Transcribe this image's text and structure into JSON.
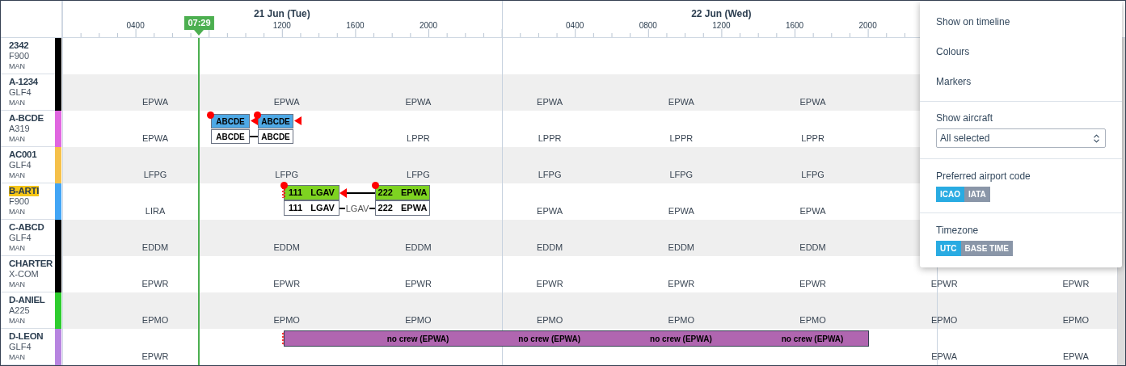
{
  "header": {
    "now_marker": "07:29",
    "days": [
      {
        "title": "21 Jun (Tue)",
        "ticks": {
          "tick_1": "0400",
          "tick_3": "1200",
          "tick_4": "1600",
          "tick_5": "2000"
        }
      },
      {
        "title": "22 Jun (Wed)",
        "ticks": {
          "tick_1": "0400",
          "tick_2": "0800",
          "tick_3": "1200",
          "tick_4": "1600",
          "tick_5": "2000"
        }
      }
    ]
  },
  "rows": [
    {
      "name": "2342",
      "type": "F900",
      "base": "MAN",
      "color": "#000000",
      "highlighted": false,
      "labels": {}
    },
    {
      "name": "A-1234",
      "type": "GLF4",
      "base": "MAN",
      "color": "#000000",
      "highlighted": false,
      "labels": {
        "slot_1": "EPWA",
        "slot_2": "EPWA",
        "slot_3": "EPWA",
        "slot_4": "EPWA",
        "slot_5": "EPWA",
        "slot_6": "EPWA"
      }
    },
    {
      "name": "A-BCDE",
      "type": "A319",
      "base": "MAN",
      "color": "#e066e0",
      "highlighted": false,
      "labels": {
        "slot_1": "EPWA",
        "slot_3": "LPPR",
        "slot_4": "LPPR",
        "slot_5": "LPPR",
        "slot_6": "LPPR"
      },
      "flights": [
        {
          "kind": "code",
          "color": "#4ea9e6",
          "top": "ABCDE",
          "bottom": "ABCDE"
        },
        {
          "kind": "code",
          "color": "#4ea9e6",
          "top": "ABCDE",
          "bottom": "ABCDE"
        }
      ]
    },
    {
      "name": "AC001",
      "type": "GLF4",
      "base": "MAN",
      "color": "#f5c04a",
      "highlighted": false,
      "labels": {
        "slot_1": "LFPG",
        "slot_2": "LFPG",
        "slot_3": "LFPG",
        "slot_4": "LFPG",
        "slot_5": "LFPG",
        "slot_6": "LFPG"
      }
    },
    {
      "name": "B-ARTI",
      "type": "F900",
      "base": "MAN",
      "color": "#42a5f5",
      "highlighted": true,
      "labels": {
        "slot_1": "LIRA",
        "slot_4": "EPWA",
        "slot_5": "EPWA",
        "slot_6": "EPWA"
      },
      "gap_label": "LGAV",
      "flights": [
        {
          "kind": "leg",
          "color": "#7ed321",
          "number": "111",
          "airport": "LGAV",
          "bottom_number": "111",
          "bottom_airport": "LGAV"
        },
        {
          "kind": "leg",
          "color": "#7ed321",
          "number": "222",
          "airport": "EPWA",
          "bottom_number": "222",
          "bottom_airport": "EPWA"
        }
      ]
    },
    {
      "name": "C-ABCD",
      "type": "GLF4",
      "base": "MAN",
      "color": "#000000",
      "highlighted": false,
      "labels": {
        "slot_1": "EDDM",
        "slot_2": "EDDM",
        "slot_3": "EDDM",
        "slot_4": "EDDM",
        "slot_5": "EDDM",
        "slot_6": "EDDM"
      }
    },
    {
      "name": "CHARTER",
      "type": "X-COM",
      "base": "MAN",
      "color": "#000000",
      "highlighted": false,
      "labels": {
        "slot_1": "EPWR",
        "slot_2": "EPWR",
        "slot_3": "EPWR",
        "slot_4": "EPWR",
        "slot_5": "EPWR",
        "slot_6": "EPWR",
        "slot_7": "EPWR",
        "slot_8": "EPWR"
      }
    },
    {
      "name": "D-ANIEL",
      "type": "A225",
      "base": "MAN",
      "color": "#2ecc2e",
      "highlighted": false,
      "labels": {
        "slot_1": "EPMO",
        "slot_2": "EPMO",
        "slot_3": "EPMO",
        "slot_4": "EPMO",
        "slot_5": "EPMO",
        "slot_6": "EPMO",
        "slot_7": "EPMO",
        "slot_8": "EPMO"
      }
    },
    {
      "name": "D-LEON",
      "type": "GLF4",
      "base": "MAN",
      "color": "#b784e0",
      "highlighted": false,
      "labels": {
        "slot_1": "EPWR",
        "slot_7": "EPWA",
        "slot_8": "EPWA"
      },
      "duty_bar": {
        "color": "#b066b0",
        "labels": [
          "no crew (EPWA)",
          "no crew (EPWA)",
          "no crew (EPWA)",
          "no crew (EPWA)"
        ]
      }
    }
  ],
  "menu": {
    "items": [
      "Show on timeline",
      "Colours",
      "Markers"
    ],
    "show_aircraft": {
      "label": "Show aircraft",
      "value": "All selected"
    },
    "airport_code": {
      "label": "Preferred airport code",
      "options": [
        {
          "label": "ICAO",
          "selected": true
        },
        {
          "label": "IATA",
          "selected": false
        }
      ]
    },
    "timezone": {
      "label": "Timezone",
      "options": [
        {
          "label": "UTC",
          "selected": true
        },
        {
          "label": "BASE TIME",
          "selected": false
        }
      ]
    }
  }
}
